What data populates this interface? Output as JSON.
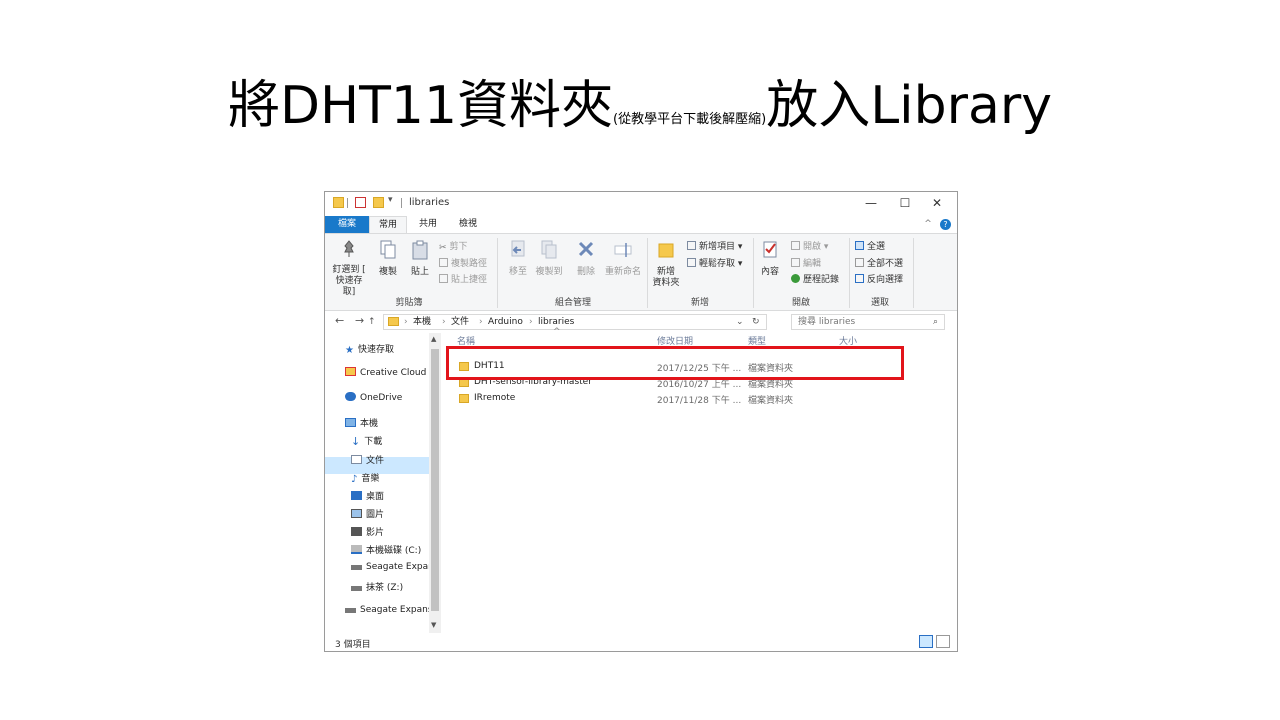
{
  "slide": {
    "title_main": "將DHT11資料夾",
    "title_sub": "(從教學平台下載後解壓縮)",
    "title_end": "放入Library"
  },
  "window": {
    "title": "libraries",
    "controls": {
      "minimize": "—",
      "maximize": "☐",
      "close": "✕"
    }
  },
  "tabs": {
    "file": "檔案",
    "home": "常用",
    "share": "共用",
    "view": "檢視",
    "collapse": "^",
    "help": "?"
  },
  "ribbon": {
    "clipboard": {
      "pin_line1": "釘選到 [",
      "pin_line2": "快速存取]",
      "copy": "複製",
      "paste": "貼上",
      "cut": "剪下",
      "copy_path": "複製路徑",
      "paste_shortcut": "貼上捷徑",
      "label": "剪貼簿"
    },
    "organize": {
      "move_to": "移至",
      "copy_to": "複製到",
      "delete": "刪除",
      "rename": "重新命名",
      "label": "組合管理"
    },
    "new": {
      "new_folder_line1": "新增",
      "new_folder_line2": "資料夾",
      "new_item": "新增項目 ▾",
      "easy_access": "輕鬆存取 ▾",
      "label": "新增"
    },
    "open": {
      "properties": "內容",
      "open": "開啟 ▾",
      "edit": "編輯",
      "history": "歷程記錄",
      "label": "開啟"
    },
    "select": {
      "select_all": "全選",
      "select_none": "全部不選",
      "invert": "反向選擇",
      "label": "選取"
    }
  },
  "address": {
    "back": "←",
    "forward": "→",
    "recent": "⌄",
    "up": "↑",
    "crumbs": [
      "本機",
      "文件",
      "Arduino",
      "libraries"
    ],
    "sep": "›",
    "dropdown": "⌄",
    "refresh": "↻",
    "search_placeholder": "搜尋 libraries",
    "search_icon": "⌕"
  },
  "navpane": {
    "quick_access": "快速存取",
    "creative_cloud": "Creative Cloud F",
    "onedrive": "OneDrive",
    "this_pc": "本機",
    "downloads": "下載",
    "documents": "文件",
    "music": "音樂",
    "desktop": "桌面",
    "pictures": "圖片",
    "videos": "影片",
    "local_disk": "本機磁碟 (C:)",
    "seagate1": "Seagate Expar",
    "drive_z": "抹茶 (Z:)",
    "seagate2": "Seagate Expans"
  },
  "columns": {
    "name": "名稱",
    "date": "修改日期",
    "type": "類型",
    "size": "大小",
    "sort_arrow": "^"
  },
  "files": [
    {
      "name": "DHT11",
      "date": "2017/12/25 下午 ...",
      "type": "檔案資料夾"
    },
    {
      "name": "DHT-sensor-library-master",
      "date": "2016/10/27 上午 ...",
      "type": "檔案資料夾"
    },
    {
      "name": "IRremote",
      "date": "2017/11/28 下午 ...",
      "type": "檔案資料夾"
    }
  ],
  "status": {
    "count": "3 個項目"
  },
  "colors": {
    "highlight_box": "#e2141a",
    "file_tab": "#1979ca",
    "folder": "#f5c84c",
    "selection": "#cce8ff"
  }
}
